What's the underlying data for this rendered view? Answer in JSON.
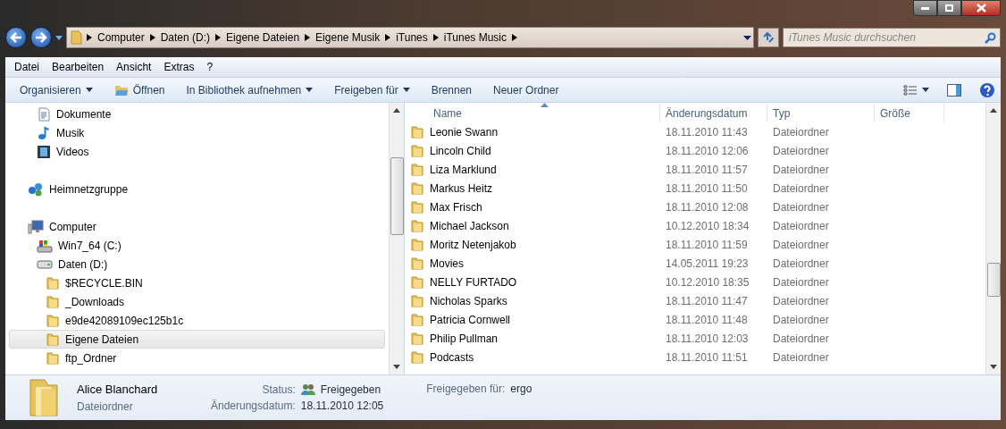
{
  "address_bar": {
    "breadcrumbs": [
      "Computer",
      "Daten (D:)",
      "Eigene Dateien",
      "Eigene Musik",
      "iTunes",
      "iTunes Music"
    ]
  },
  "search": {
    "placeholder": "iTunes Music durchsuchen"
  },
  "menu": [
    "Datei",
    "Bearbeiten",
    "Ansicht",
    "Extras",
    "?"
  ],
  "toolbar": [
    {
      "label": "Organisieren",
      "kind": "dropdown"
    },
    {
      "label": "Öffnen",
      "kind": "open"
    },
    {
      "label": "In Bibliothek aufnehmen",
      "kind": "dropdown"
    },
    {
      "label": "Freigeben für",
      "kind": "dropdown"
    },
    {
      "label": "Brennen",
      "kind": "plain"
    },
    {
      "label": "Neuer Ordner",
      "kind": "plain"
    }
  ],
  "sidebar": {
    "items": [
      {
        "label": "Dokumente",
        "kind": "documents",
        "selected": false
      },
      {
        "label": "Musik",
        "kind": "music",
        "selected": false
      },
      {
        "label": "Videos",
        "kind": "videos",
        "selected": false
      },
      {
        "label": "Heimnetzgruppe",
        "kind": "network",
        "selected": false
      },
      {
        "label": "Computer",
        "kind": "computer",
        "selected": false,
        "children": [
          {
            "label": "Win7_64 (C:)",
            "kind": "system-drive",
            "selected": false
          },
          {
            "label": "Daten (D:)",
            "kind": "drive",
            "selected": false,
            "children": [
              {
                "label": "$RECYCLE.BIN",
                "kind": "folder",
                "selected": false
              },
              {
                "label": "_Downloads",
                "kind": "folder",
                "selected": false
              },
              {
                "label": "e9de42089109ec125b1c",
                "kind": "folder",
                "selected": false
              },
              {
                "label": "Eigene Dateien",
                "kind": "folder",
                "selected": true
              },
              {
                "label": "ftp_Ordner",
                "kind": "folder",
                "selected": false
              }
            ]
          }
        ]
      }
    ]
  },
  "table": {
    "columns": [
      {
        "label": "Name",
        "sorted": true
      },
      {
        "label": "Änderungsdatum",
        "sorted": false
      },
      {
        "label": "Typ",
        "sorted": false
      },
      {
        "label": "Größe",
        "sorted": false
      }
    ],
    "rows": [
      [
        "Leonie Swann",
        "18.11.2010 11:43",
        "Dateiordner"
      ],
      [
        "Lincoln Child",
        "18.11.2010 12:06",
        "Dateiordner"
      ],
      [
        "Liza Marklund",
        "18.11.2010 11:57",
        "Dateiordner"
      ],
      [
        "Markus Heitz",
        "18.11.2010 11:50",
        "Dateiordner"
      ],
      [
        "Max Frisch",
        "18.11.2010 12:08",
        "Dateiordner"
      ],
      [
        "Michael Jackson",
        "10.12.2010 18:34",
        "Dateiordner"
      ],
      [
        "Moritz Netenjakob",
        "18.11.2010 11:59",
        "Dateiordner"
      ],
      [
        "Movies",
        "14.05.2011 19:23",
        "Dateiordner"
      ],
      [
        "NELLY FURTADO",
        "10.12.2010 18:35",
        "Dateiordner"
      ],
      [
        "Nicholas Sparks",
        "18.11.2010 11:47",
        "Dateiordner"
      ],
      [
        "Patricia Cornwell",
        "18.11.2010 11:48",
        "Dateiordner"
      ],
      [
        "Philip Pullman",
        "18.11.2010 12:03",
        "Dateiordner"
      ],
      [
        "Podcasts",
        "18.11.2010 11:51",
        "Dateiordner"
      ]
    ]
  },
  "details": {
    "name": "Alice Blanchard",
    "type": "Dateiordner",
    "status_label": "Status:",
    "status_value": "Freigegeben",
    "date_label": "Änderungsdatum:",
    "date_value": "18.11.2010 12:05",
    "shared_label": "Freigegeben für:",
    "shared_value": "ergo"
  }
}
